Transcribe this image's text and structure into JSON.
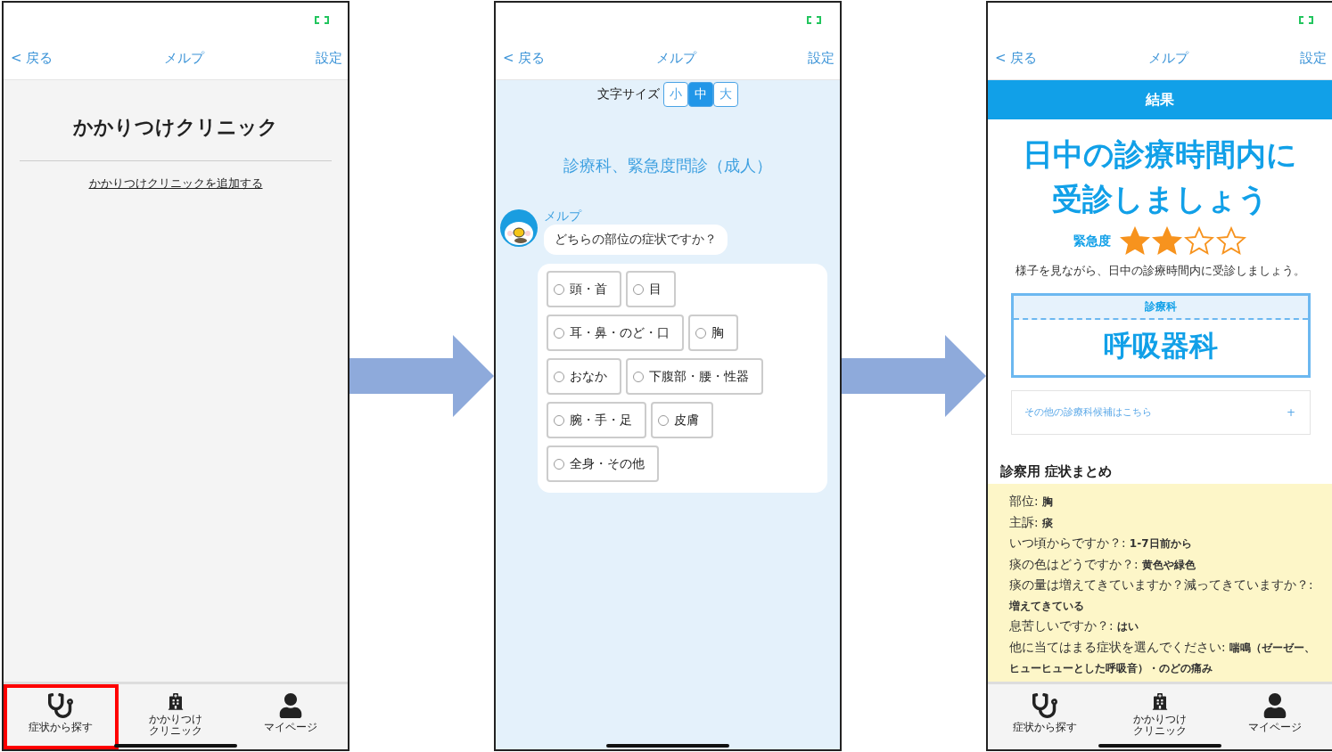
{
  "screens": [
    {
      "kind": "clinic",
      "nav": {
        "back": "< 戻る",
        "title": "メルプ",
        "settings": "設定"
      },
      "title": "かかりつけクリニック",
      "link": "かかりつけクリニックを追加する",
      "tabs": [
        {
          "kind": "stethoscope",
          "lines": [
            "症状から探す"
          ],
          "highlighted": true
        },
        {
          "kind": "hospital",
          "lines": [
            "かかりつけ",
            "クリニック"
          ],
          "highlighted": false
        },
        {
          "kind": "person",
          "lines": [
            "マイページ"
          ],
          "highlighted": false
        }
      ]
    },
    {
      "kind": "chat",
      "nav": {
        "back": "< 戻る",
        "title": "メルプ",
        "settings": "設定"
      },
      "font_size_label": "文字サイズ",
      "font_sizes": [
        {
          "label": "小",
          "selected": false
        },
        {
          "label": "中",
          "selected": true
        },
        {
          "label": "大",
          "selected": false
        }
      ],
      "heading": "診療科、緊急度問診（成人）",
      "bot_name": "メルプ",
      "question": "どちらの部位の症状ですか？",
      "options": [
        [
          {
            "label": "頭・首",
            "checked": false
          },
          {
            "label": "目",
            "checked": false
          }
        ],
        [
          {
            "label": "耳・鼻・のど・口",
            "checked": false
          },
          {
            "label": "胸",
            "checked": false
          }
        ],
        [
          {
            "label": "おなか",
            "checked": false
          },
          {
            "label": "下腹部・腰・性器",
            "checked": false
          }
        ],
        [
          {
            "label": "腕・手・足",
            "checked": false
          },
          {
            "label": "皮膚",
            "checked": false
          }
        ],
        [
          {
            "label": "全身・その他",
            "checked": false
          }
        ]
      ]
    },
    {
      "kind": "result",
      "nav": {
        "back": "< 戻る",
        "title": "メルプ",
        "settings": "設定"
      },
      "banner": "結果",
      "headline": [
        "日中の診療時間内に",
        "受診しましょう"
      ],
      "urgency_label": "緊急度",
      "stars": 2,
      "advice": "様子を見ながら、日中の診療時間内に受診しましょう。",
      "department": {
        "label": "診療科",
        "name": "呼吸器科"
      },
      "other_departments": {
        "label": "その他の診療科候補はこちら",
        "icon": "+",
        "expanded": false
      },
      "summary_title": "診察用 症状まとめ",
      "summary": [
        "部位: **胸**",
        "主訴: **痰**",
        "いつ頃からですか？: **1-7日前から**",
        "痰の色はどうですか？: **黄色や緑色**",
        "痰の量は増えてきていますか？減ってきていますか？: **増えてきている**",
        "息苦しいですか？: **はい**",
        "他に当てはまる症状を選んでください: **喘鳴（ゼーゼー、ヒューヒューとした呼吸音）・のどの痛み**"
      ],
      "tabs": [
        {
          "kind": "stethoscope",
          "lines": [
            "症状から探す"
          ],
          "highlighted": false
        },
        {
          "kind": "hospital",
          "lines": [
            "かかりつけ",
            "クリニック"
          ],
          "highlighted": false
        },
        {
          "kind": "person",
          "lines": [
            "マイページ"
          ],
          "highlighted": false
        }
      ]
    }
  ]
}
